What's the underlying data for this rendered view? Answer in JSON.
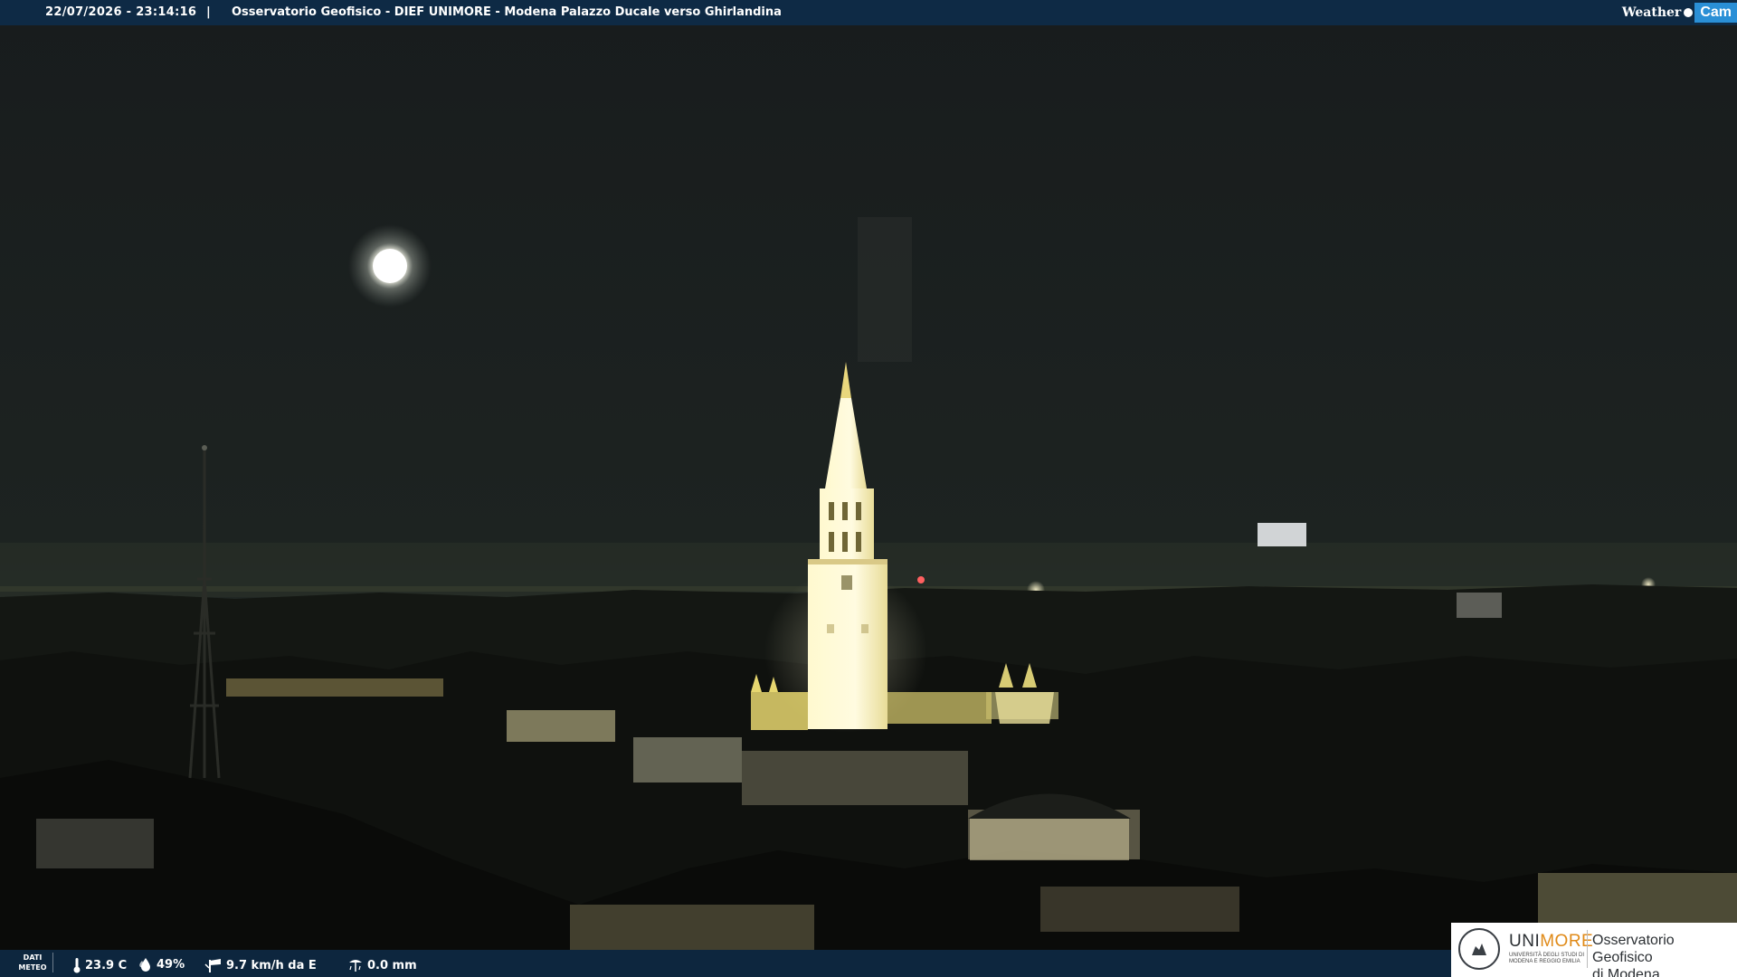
{
  "header": {
    "timestamp": "22/07/2026 - 23:14:16",
    "separator": "|",
    "title": "Osservatorio Geofisico - DIEF UNIMORE - Modena Palazzo Ducale verso Ghirlandina",
    "logo_weather": "Weather",
    "logo_cam": "Cam"
  },
  "weather": {
    "label_line1": "DATI",
    "label_line2": "METEO",
    "temperature": "23.9 C",
    "humidity": "49%",
    "wind": "9.7 km/h da E",
    "rain": "0.0 mm"
  },
  "branding": {
    "uni": "UNI",
    "more": "MORE",
    "uni_sub1": "UNIVERSITÀ DEGLI STUDI DI",
    "uni_sub2": "MODENA E REGGIO EMILIA",
    "observatory_line1": "Osservatorio Geofisico",
    "observatory_line2": "di Modena"
  },
  "icons": [
    "thermometer-icon",
    "droplet-icon",
    "wind-icon",
    "rain-gauge-icon"
  ],
  "colors": {
    "bar": "#0e2a45",
    "cam_badge": "#2a8fd6",
    "unimore_orange": "#e08a18",
    "sky": "#1a1f1e",
    "tower_light": "#fff6c8"
  }
}
